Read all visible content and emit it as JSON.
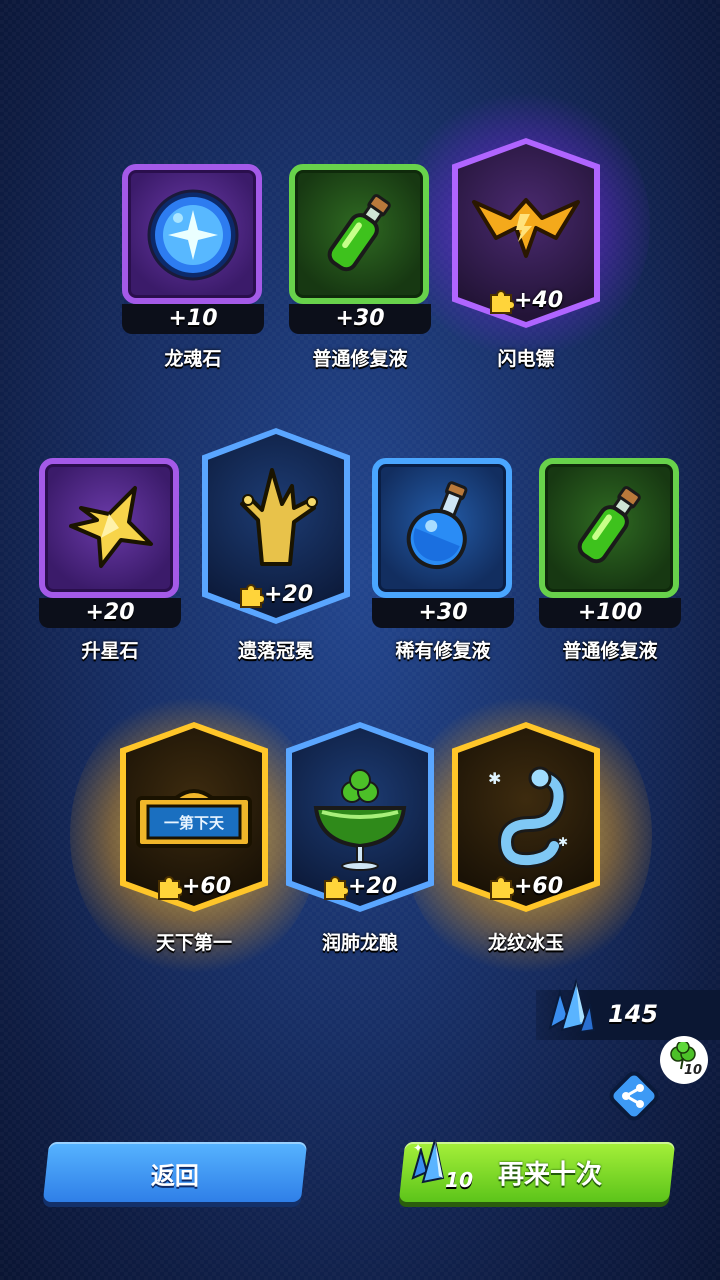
{
  "rewards": [
    {
      "name": "龙魂石",
      "count": "+10",
      "rarity": "purple",
      "frame": "card",
      "icon": "dragon-soul-stone-icon"
    },
    {
      "name": "普通修复液",
      "count": "+30",
      "rarity": "green",
      "frame": "card",
      "icon": "green-potion-icon"
    },
    {
      "name": "闪电镖",
      "count": "+40",
      "rarity": "purple",
      "frame": "hex",
      "icon": "lightning-dart-icon",
      "fragment": true
    },
    {
      "name": "升星石",
      "count": "+20",
      "rarity": "purple",
      "frame": "card",
      "icon": "star-stone-icon"
    },
    {
      "name": "遗落冠冕",
      "count": "+20",
      "rarity": "blue",
      "frame": "hex",
      "icon": "lost-crown-icon",
      "fragment": true
    },
    {
      "name": "稀有修复液",
      "count": "+30",
      "rarity": "blue",
      "frame": "card",
      "icon": "blue-potion-icon"
    },
    {
      "name": "普通修复液",
      "count": "+100",
      "rarity": "green",
      "frame": "card",
      "icon": "green-potion-icon"
    },
    {
      "name": "天下第一",
      "count": "+60",
      "rarity": "gold",
      "frame": "hex",
      "icon": "plaque-icon",
      "fragment": true,
      "plaque_text": "一第下天"
    },
    {
      "name": "润肺龙酿",
      "count": "+20",
      "rarity": "blue",
      "frame": "hex",
      "icon": "cocktail-icon",
      "fragment": true
    },
    {
      "name": "龙纹冰玉",
      "count": "+60",
      "rarity": "gold",
      "frame": "hex",
      "icon": "ice-dragon-icon",
      "fragment": true
    }
  ],
  "currency": {
    "crystal_count": "145",
    "icon": "blue-crystal-icon"
  },
  "share": {
    "clover_count": "10"
  },
  "buttons": {
    "back_label": "返回",
    "again_label": "再来十次",
    "again_cost": "10"
  },
  "colors": {
    "purple": "#a45ae8",
    "green": "#68d24b",
    "blue": "#4aa6ff",
    "gold": "#ffc629",
    "back_button": "#3a8ef0",
    "again_button": "#7fd82a"
  }
}
